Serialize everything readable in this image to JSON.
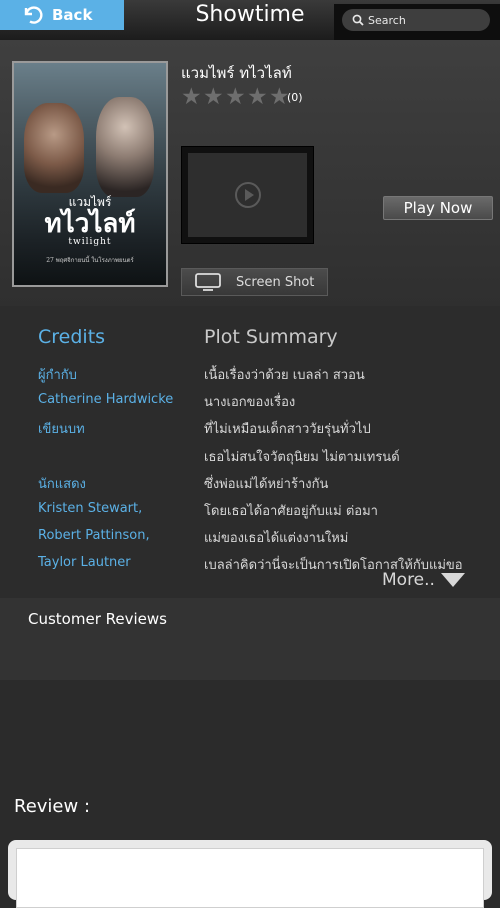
{
  "header": {
    "back_label": "Back",
    "title": "Showtime",
    "search_placeholder": "Search"
  },
  "movie": {
    "title": "แวมไพร์ ทไวไลท์",
    "rating_stars": 0,
    "rating_max": 5,
    "rating_count": "(0)",
    "play_now_label": "Play Now",
    "screenshot_label": "Screen Shot",
    "poster": {
      "title_line1": "แวมไพร์",
      "title_line2": "ทไวไลท์",
      "title_line3": "twilight",
      "footer": "27 พฤศจิกายนนี้ ในโรงภาพยนตร์"
    }
  },
  "credits": {
    "heading": "Credits",
    "director_label": "ผู้กำกับ",
    "director": "Catherine Hardwicke",
    "writer_label": "เขียนบท",
    "cast_label": "นักแสดง",
    "cast": [
      "Kristen Stewart,",
      "Robert Pattinson,",
      "Taylor Lautner"
    ]
  },
  "plot": {
    "heading": "Plot Summary",
    "lines": [
      "เนื้อเรื่องว่าด้วย เบลล่า สวอน",
      "นางเอกของเรื่อง",
      "ที่ไม่เหมือนเด็กสาววัยรุ่นทั่วไป",
      "เธอไม่สนใจวัตถุนิยม ไม่ตามเทรนด์",
      "ซึ่งพ่อแม่ได้หย่าร้างกัน",
      "โดยเธอได้อาศัยอยู่กับแม่ ต่อมา",
      "แม่ของเธอได้แต่งงานใหม่",
      "เบลล่าคิดว่านี่จะเป็นการเปิดโอกาสให้กับแม่ขอ"
    ],
    "more_label": "More.."
  },
  "reviews": {
    "heading": "Customer Reviews",
    "review_label": "Review :"
  },
  "colors": {
    "accent": "#5bb1e6",
    "background": "#2b2b2b",
    "star_empty": "#6e6e6e"
  }
}
